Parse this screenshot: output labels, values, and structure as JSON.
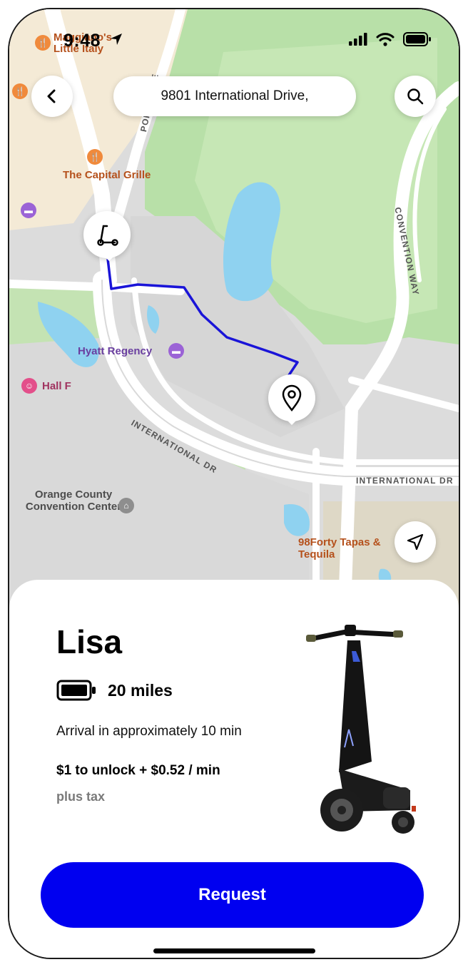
{
  "status_bar": {
    "time": "9:48"
  },
  "search": {
    "address": "9801 International Drive,"
  },
  "map": {
    "labels": {
      "little_italy": "Little Italy",
      "little_italy_top": "Maggiano's",
      "capital_grille": "The Capital Grille",
      "hyatt": "Hyatt Regency",
      "hall_f": "Hall F",
      "convention_center": "Orange County Convention Center",
      "tapas": "98Forty Tapas & Tequila",
      "intl_dr_diag": "INTERNATIONAL DR",
      "intl_dr_h": "INTERNATIONAL DR",
      "convention_way": "CONVENTION WAY",
      "pointe_ave": "POINTE AVE"
    }
  },
  "scooter": {
    "name": "Lisa",
    "range": "20 miles",
    "arrival": "Arrival in approximately 10 min",
    "price": "$1 to unlock + $0.52 / min",
    "tax_note": "plus tax"
  },
  "actions": {
    "request_label": "Request"
  },
  "colors": {
    "accent": "#0000f0",
    "route": "#1a14d8"
  }
}
